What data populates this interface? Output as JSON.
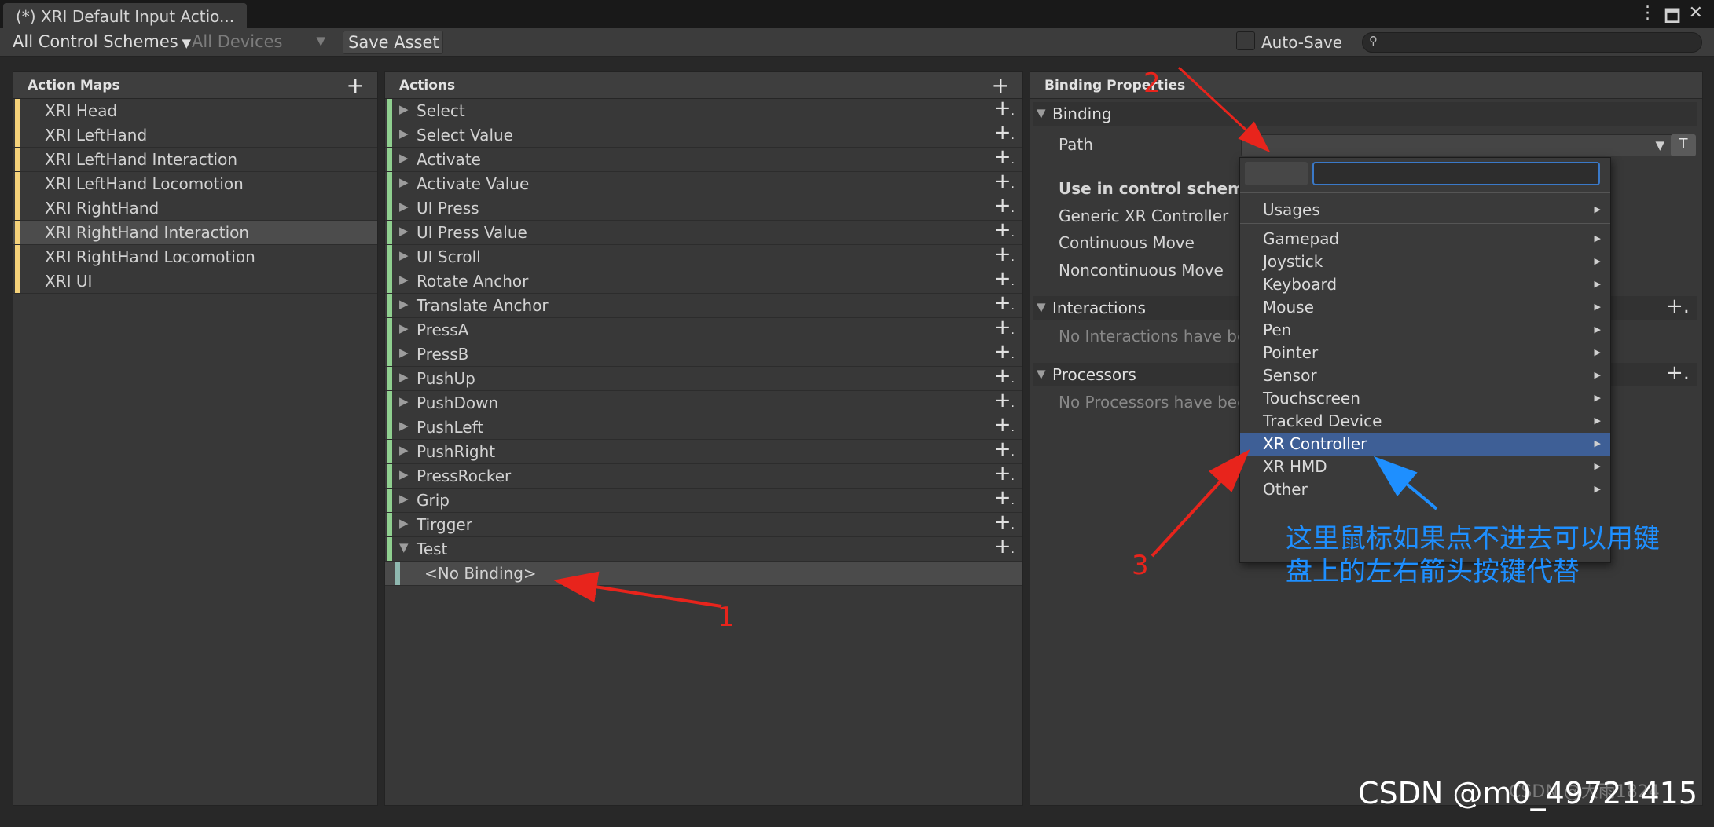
{
  "window": {
    "tab_title": "(*) XRI Default Input Actio...",
    "controls": [
      "⋮",
      "🗖",
      "✕"
    ]
  },
  "toolbar": {
    "control_schemes": "All Control Schemes",
    "devices": "All Devices",
    "save_asset": "Save Asset",
    "auto_save": "Auto-Save",
    "search_icon": "🔍",
    "search_value": ""
  },
  "action_maps": {
    "header": "Action Maps",
    "add_icon": "+",
    "items": [
      {
        "label": "XRI Head"
      },
      {
        "label": "XRI LeftHand"
      },
      {
        "label": "XRI LeftHand Interaction"
      },
      {
        "label": "XRI LeftHand Locomotion"
      },
      {
        "label": "XRI RightHand"
      },
      {
        "label": "XRI RightHand Interaction"
      },
      {
        "label": "XRI RightHand Locomotion"
      },
      {
        "label": "XRI UI"
      }
    ],
    "selected_index": 5,
    "stripe_color": "#f5d27a"
  },
  "actions": {
    "header": "Actions",
    "add_icon": "+",
    "stripe_color": "#8fcf8f",
    "items": [
      {
        "label": "Select"
      },
      {
        "label": "Select Value"
      },
      {
        "label": "Activate"
      },
      {
        "label": "Activate Value"
      },
      {
        "label": "UI Press"
      },
      {
        "label": "UI Press Value"
      },
      {
        "label": "UI Scroll"
      },
      {
        "label": "Rotate Anchor"
      },
      {
        "label": "Translate Anchor"
      },
      {
        "label": "PressA"
      },
      {
        "label": "PressB"
      },
      {
        "label": "PushUp"
      },
      {
        "label": "PushDown"
      },
      {
        "label": "PushLeft"
      },
      {
        "label": "PushRight"
      },
      {
        "label": "PressRocker"
      },
      {
        "label": "Grip"
      },
      {
        "label": "Tirgger"
      },
      {
        "label": "Test",
        "expanded": true
      }
    ],
    "binding": {
      "label": "<No Binding>",
      "stripe_color": "#8fb8b0"
    }
  },
  "binding_properties": {
    "header": "Binding Properties",
    "binding_section": "Binding",
    "path_label": "Path",
    "path_value": "",
    "t_button": "T",
    "use_in_scheme_label": "Use in control scheme",
    "schemes": [
      "Generic XR Controller",
      "Continuous Move",
      "Noncontinuous Move"
    ],
    "interactions_section": "Interactions",
    "interactions_empty": "No Interactions have bee",
    "processors_section": "Processors",
    "processors_empty": "No Processors have bee"
  },
  "path_dropdown": {
    "items": [
      {
        "label": "Usages"
      },
      {
        "label": "Gamepad"
      },
      {
        "label": "Joystick"
      },
      {
        "label": "Keyboard"
      },
      {
        "label": "Mouse"
      },
      {
        "label": "Pen"
      },
      {
        "label": "Pointer"
      },
      {
        "label": "Sensor"
      },
      {
        "label": "Touchscreen"
      },
      {
        "label": "Tracked Device"
      },
      {
        "label": "XR Controller"
      },
      {
        "label": "XR HMD"
      },
      {
        "label": "Other"
      }
    ],
    "highlighted_index": 10,
    "highlight_color": "#3e5f96"
  },
  "annotations": {
    "num1": "1",
    "num2": "2",
    "num3": "3",
    "note": "这里鼠标如果点不进去可以用键盘上的左右箭头按键代替",
    "watermark": "CSDN @m0_49721415",
    "watermark_ghost": "CSDN @大雨1824",
    "arrow_red": "#e8241c",
    "arrow_blue": "#1e8fff"
  }
}
